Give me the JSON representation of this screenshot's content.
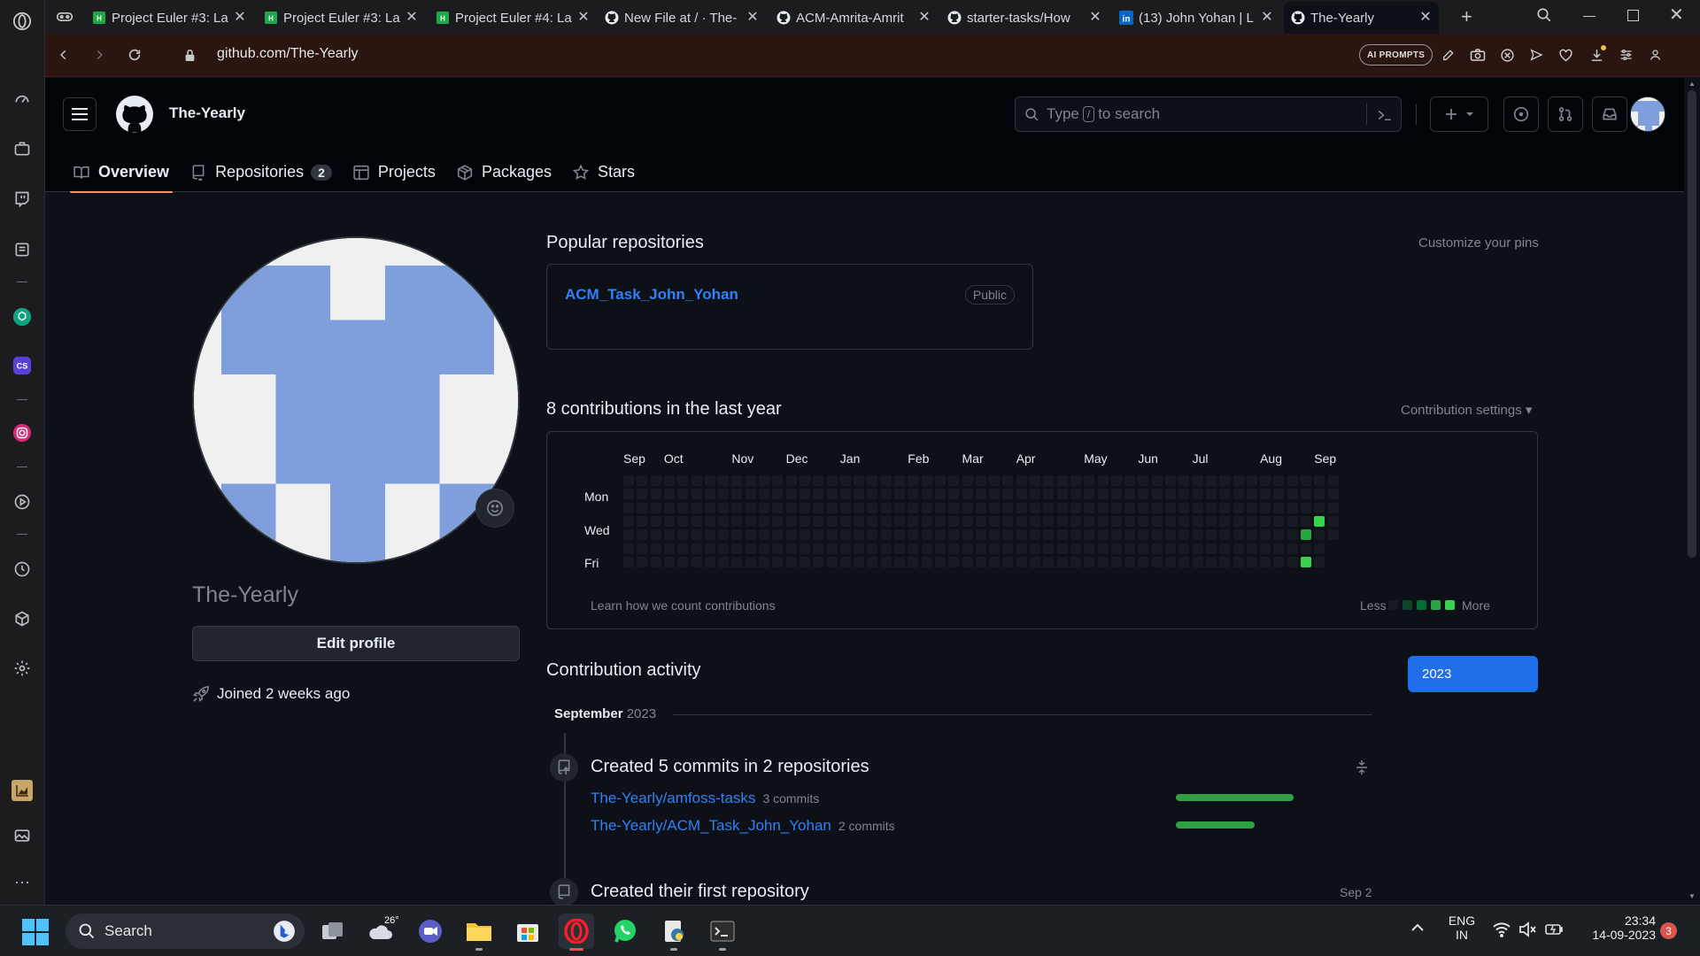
{
  "browser": {
    "tabs": [
      {
        "title": "Project Euler #3: La",
        "favicon": "hackerrank-icon"
      },
      {
        "title": "Project Euler #3: La",
        "favicon": "hackerrank-icon"
      },
      {
        "title": "Project Euler #4: La",
        "favicon": "hackerrank-icon"
      },
      {
        "title": "New File at / · The-",
        "favicon": "github-icon"
      },
      {
        "title": "ACM-Amrita-Amrit",
        "favicon": "github-icon"
      },
      {
        "title": "starter-tasks/How",
        "favicon": "github-icon"
      },
      {
        "title": "(13) John Yohan | L",
        "favicon": "linkedin-icon"
      },
      {
        "title": "The-Yearly",
        "favicon": "github-icon",
        "active": true
      }
    ],
    "url": "github.com/The-Yearly",
    "ai_prompts_label": "AI PROMPTS"
  },
  "github": {
    "username": "The-Yearly",
    "search": {
      "prefix": "Type",
      "key": "/",
      "suffix": "to search"
    },
    "nav": [
      {
        "label": "Overview",
        "icon": "book-icon",
        "active": true
      },
      {
        "label": "Repositories",
        "icon": "repo-icon",
        "count": "2"
      },
      {
        "label": "Projects",
        "icon": "table-icon"
      },
      {
        "label": "Packages",
        "icon": "package-icon"
      },
      {
        "label": "Stars",
        "icon": "star-icon"
      }
    ],
    "profile": {
      "login": "The-Yearly",
      "edit_label": "Edit profile",
      "joined": "Joined 2 weeks ago"
    },
    "popular": {
      "title": "Popular repositories",
      "customize": "Customize your pins",
      "repos": [
        {
          "name": "ACM_Task_John_Yohan",
          "visibility": "Public"
        }
      ]
    },
    "contributions": {
      "title": "8 contributions in the last year",
      "settings": "Contribution settings ▾",
      "months": [
        "Sep",
        "Oct",
        "Nov",
        "Dec",
        "Jan",
        "Feb",
        "Mar",
        "Apr",
        "May",
        "Jun",
        "Jul",
        "Aug",
        "Sep"
      ],
      "days": [
        "Mon",
        "Wed",
        "Fri"
      ],
      "learn": "Learn how we count contributions",
      "less": "Less",
      "more": "More",
      "level_colors": [
        "#161b22",
        "#0e4429",
        "#006d32",
        "#26a641",
        "#39d353"
      ],
      "active_cells": [
        {
          "week": 51,
          "day": 3,
          "level": 4
        },
        {
          "week": 50,
          "day": 4,
          "level": 3
        },
        {
          "week": 50,
          "day": 6,
          "level": 4
        }
      ]
    },
    "activity": {
      "title": "Contribution activity",
      "year": "2023",
      "month": "September",
      "month_year": "2023",
      "commits_title": "Created 5 commits in 2 repositories",
      "repos": [
        {
          "name": "The-Yearly/amfoss-tasks",
          "count": "3 commits",
          "share": 1.0
        },
        {
          "name": "The-Yearly/ACM_Task_John_Yohan",
          "count": "2 commits",
          "share": 0.67
        }
      ],
      "first_repo_title": "Created their first repository",
      "first_repo_date": "Sep 2"
    }
  },
  "taskbar": {
    "search": "Search",
    "weather_temp": "26°",
    "lang": "ENG",
    "region": "IN",
    "time": "23:34",
    "date": "14-09-2023",
    "notifications": "3"
  }
}
